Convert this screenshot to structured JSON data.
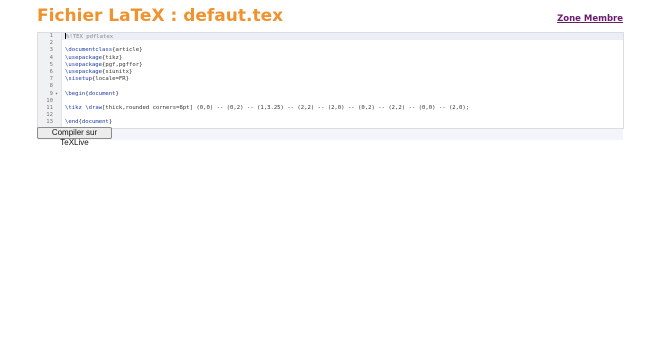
{
  "header": {
    "title": "Fichier LaTeX : defaut.tex",
    "member_link": "Zone Membre"
  },
  "editor": {
    "lines": [
      {
        "num": "1",
        "parts": [
          [
            "cm",
            "%!TEX pdflatex"
          ]
        ],
        "active": true
      },
      {
        "num": "2",
        "parts": []
      },
      {
        "num": "3",
        "parts": [
          [
            "kw",
            "\\documentclass"
          ],
          [
            "",
            "{article}"
          ]
        ]
      },
      {
        "num": "4",
        "parts": [
          [
            "kw",
            "\\usepackage"
          ],
          [
            "",
            "{tikz}"
          ]
        ]
      },
      {
        "num": "5",
        "parts": [
          [
            "kw",
            "\\usepackage"
          ],
          [
            "",
            "{pgf,pgffor}"
          ]
        ]
      },
      {
        "num": "6",
        "parts": [
          [
            "kw",
            "\\usepackage"
          ],
          [
            "",
            "{siunitx}"
          ]
        ]
      },
      {
        "num": "7",
        "parts": [
          [
            "kw",
            "\\sisetup"
          ],
          [
            "",
            "{locale=FR}"
          ]
        ]
      },
      {
        "num": "8",
        "parts": []
      },
      {
        "num": "9",
        "parts": [
          [
            "kw",
            "\\begin"
          ],
          [
            "",
            "{"
          ],
          [
            "kw",
            "document"
          ],
          [
            "",
            "}"
          ]
        ],
        "fold": true
      },
      {
        "num": "10",
        "parts": []
      },
      {
        "num": "11",
        "parts": [
          [
            "kw",
            "\\tikz"
          ],
          [
            "",
            " "
          ],
          [
            "kw",
            "\\draw"
          ],
          [
            "",
            "[thick,rounded corners=8pt] (0,0) -- (0,2) -- (1,3.25) -- (2,2) -- (2,0) -- (0,2) -- (2,2) -- (0,0) -- (2,0);"
          ]
        ]
      },
      {
        "num": "12",
        "parts": []
      },
      {
        "num": "13",
        "parts": [
          [
            "kw",
            "\\end"
          ],
          [
            "",
            "{"
          ],
          [
            "kw",
            "document"
          ],
          [
            "",
            "}"
          ]
        ]
      }
    ],
    "fold_marker": "▾"
  },
  "actions": {
    "compile_label": "Compiler sur TeXLive"
  },
  "colors": {
    "title": "#f0922e",
    "link": "#6a1b6d",
    "keyword": "#1b3aa8"
  }
}
